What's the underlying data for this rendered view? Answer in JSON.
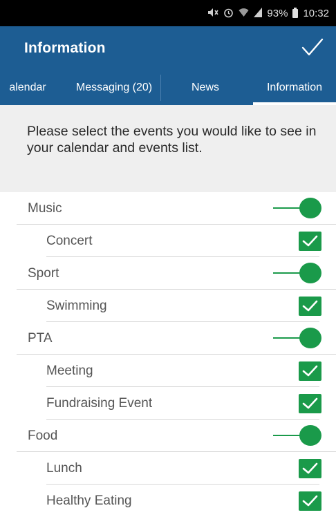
{
  "status_bar": {
    "battery_percent": "93%",
    "time": "10:32",
    "icons": [
      "mute-icon",
      "alarm-icon",
      "wifi-icon",
      "signal-icon",
      "battery-icon"
    ]
  },
  "header": {
    "title": "Information",
    "action_icon": "checkmark-icon"
  },
  "tabs": [
    {
      "label": "alendar"
    },
    {
      "label": "Messaging (20)"
    },
    {
      "label": "News"
    },
    {
      "label": "Information",
      "active": true
    }
  ],
  "intro": {
    "text": "Please select the events you would like to see in your calendar and events list."
  },
  "categories": [
    {
      "label": "Music",
      "enabled": true,
      "items": [
        {
          "label": "Concert",
          "checked": true
        }
      ]
    },
    {
      "label": "Sport",
      "enabled": true,
      "items": [
        {
          "label": "Swimming",
          "checked": true
        }
      ]
    },
    {
      "label": "PTA",
      "enabled": true,
      "items": [
        {
          "label": "Meeting",
          "checked": true
        },
        {
          "label": "Fundraising Event",
          "checked": true
        }
      ]
    },
    {
      "label": "Food",
      "enabled": true,
      "items": [
        {
          "label": "Lunch",
          "checked": true
        },
        {
          "label": "Healthy Eating",
          "checked": true
        }
      ]
    }
  ],
  "colors": {
    "primary": "#1d5d93",
    "accent": "#1a9a4a",
    "intro_background": "#efefef"
  }
}
